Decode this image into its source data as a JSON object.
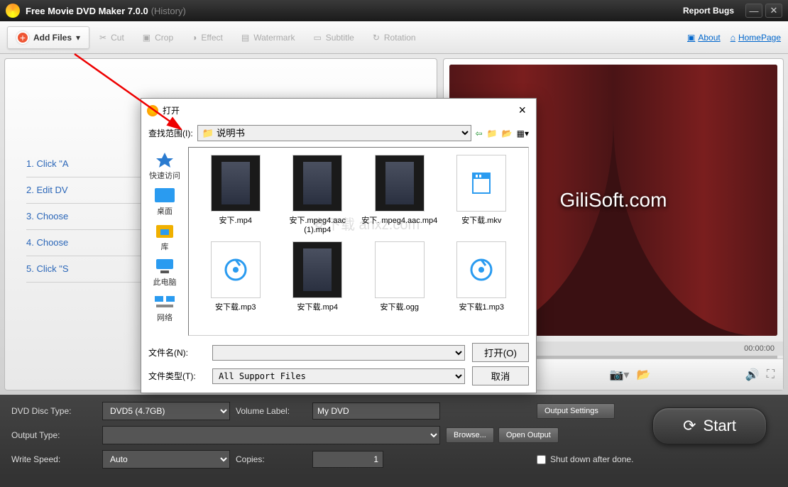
{
  "titlebar": {
    "title": "Free Movie DVD Maker 7.0.0",
    "history": "(History)",
    "report": "Report Bugs"
  },
  "toolbar": {
    "add": "Add Files",
    "cut": "Cut",
    "crop": "Crop",
    "effect": "Effect",
    "watermark": "Watermark",
    "subtitle": "Subtitle",
    "rotation": "Rotation",
    "about": "About",
    "homepage": "HomePage"
  },
  "steps": {
    "s1": "1. Click \"A",
    "s2": "2. Edit  DV",
    "s3": "3. Choose",
    "s4": "4. Choose",
    "s5": "5. Click \"S"
  },
  "preview": {
    "brand": "GiliSoft.com",
    "t0": "00:00:00",
    "t1": "00:00:00"
  },
  "bottom": {
    "disc_label": "DVD Disc Type:",
    "disc_value": "DVD5 (4.7GB)",
    "vol_label": "Volume Label:",
    "vol_value": "My DVD",
    "outset": "Output Settings",
    "out_label": "Output Type:",
    "browse": "Browse...",
    "openout": "Open Output",
    "speed_label": "Write Speed:",
    "speed_value": "Auto",
    "copies_label": "Copies:",
    "copies_value": "1",
    "shutdown": "Shut down after done.",
    "start": "Start"
  },
  "dialog": {
    "title": "打开",
    "look_label": "查找范围(I):",
    "look_value": "说明书",
    "side": {
      "quick": "快速访问",
      "desktop": "桌面",
      "lib": "库",
      "pc": "此电脑",
      "net": "网络"
    },
    "files": [
      {
        "name": "安下.mp4",
        "kind": "video"
      },
      {
        "name": "安下.mpeg4.aac (1).mp4",
        "kind": "video"
      },
      {
        "name": "安下. mpeg4.aac.mp4",
        "kind": "video"
      },
      {
        "name": "安下载.mkv",
        "kind": "doc"
      },
      {
        "name": "安下载.mp3",
        "kind": "audio"
      },
      {
        "name": "安下载.mp4",
        "kind": "video"
      },
      {
        "name": "安下载.ogg",
        "kind": "blank"
      },
      {
        "name": "安下载1.mp3",
        "kind": "audio"
      }
    ],
    "fname_label": "文件名(N):",
    "ftype_label": "文件类型(T):",
    "ftype_value": "All Support Files",
    "open_btn": "打开(O)",
    "cancel_btn": "取消"
  },
  "watermark": "安下载\nanxz.com"
}
